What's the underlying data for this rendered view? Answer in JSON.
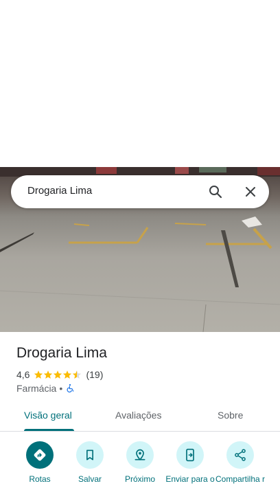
{
  "search": {
    "query": "Drogaria Lima",
    "search_icon": "search-icon",
    "close_icon": "close-icon"
  },
  "photo": {
    "description_icon": "street-photo"
  },
  "place": {
    "title": "Drogaria Lima",
    "rating": "4,6",
    "stars": 4.5,
    "reviews": "(19)",
    "category": "Farmácia",
    "separator": "•",
    "accessibility_icon": "wheelchair-icon"
  },
  "tabs": [
    {
      "label": "Visão geral",
      "active": true
    },
    {
      "label": "Avaliações",
      "active": false
    },
    {
      "label": "Sobre",
      "active": false
    }
  ],
  "actions": [
    {
      "label": "Rotas",
      "icon": "directions-icon"
    },
    {
      "label": "Salvar",
      "icon": "bookmark-icon"
    },
    {
      "label": "Próximo",
      "icon": "nearby-icon"
    },
    {
      "label": "Enviar para o",
      "icon": "send-to-phone-icon"
    },
    {
      "label": "Compartilha r",
      "icon": "share-icon"
    }
  ],
  "colors": {
    "accent": "#00707a",
    "accent_light": "#d1f5f8",
    "star": "#fbbc04"
  }
}
